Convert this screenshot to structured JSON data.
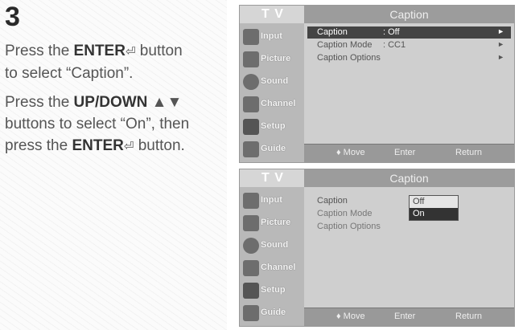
{
  "step": "3",
  "instruction1": {
    "line1_pre": "Press the ",
    "line1_bold": "ENTER",
    "enter_symbol": "⏎",
    "line1_post": " button",
    "line2": "to select “Caption”."
  },
  "instruction2": {
    "line1_pre": "Press the ",
    "line1_bold": "UP/DOWN",
    "arrows": "▲▼",
    "line2": "buttons to select “On”, then",
    "line3_pre": "press the ",
    "line3_bold": "ENTER",
    "line3_post": " button."
  },
  "osd": {
    "tv_label": "T V",
    "title": "Caption",
    "sidebar": [
      "Input",
      "Picture",
      "Sound",
      "Channel",
      "Setup",
      "Guide"
    ],
    "footer": {
      "move": "♦ Move",
      "enter": "Enter",
      "return": "Return"
    }
  },
  "screen1": {
    "rows": [
      {
        "label": "Caption",
        "value": ": Off",
        "arrow": "►"
      },
      {
        "label": "Caption Mode",
        "value": ": CC1",
        "arrow": "►"
      },
      {
        "label": "Caption Options",
        "value": "",
        "arrow": "►"
      }
    ]
  },
  "screen2": {
    "rows": [
      "Caption",
      "Caption Mode",
      "Caption Options"
    ],
    "options": [
      "Off",
      "On"
    ]
  }
}
